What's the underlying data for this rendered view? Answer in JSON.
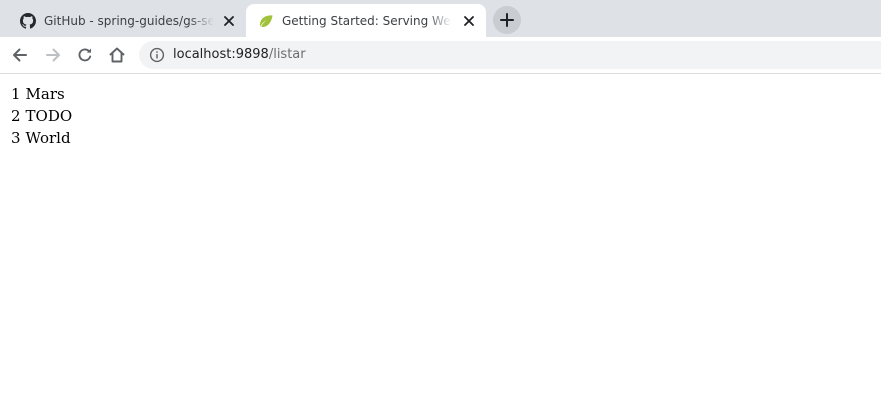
{
  "browser": {
    "tabs": [
      {
        "title": "GitHub - spring-guides/gs-serving-web-content",
        "favicon": "github-icon",
        "active": false
      },
      {
        "title": "Getting Started: Serving Web Content",
        "favicon": "spring-leaf-icon",
        "active": true
      }
    ],
    "address_bar": {
      "host": "localhost:9898",
      "path": "/listar"
    },
    "colors": {
      "tab_strip": "#dee1e6",
      "active_tab": "#ffffff",
      "omnibox": "#f1f3f4",
      "spring_leaf": "#9fc23a"
    }
  },
  "page": {
    "items": [
      {
        "id": "1",
        "name": "Mars"
      },
      {
        "id": "2",
        "name": "TODO"
      },
      {
        "id": "3",
        "name": "World"
      }
    ]
  }
}
